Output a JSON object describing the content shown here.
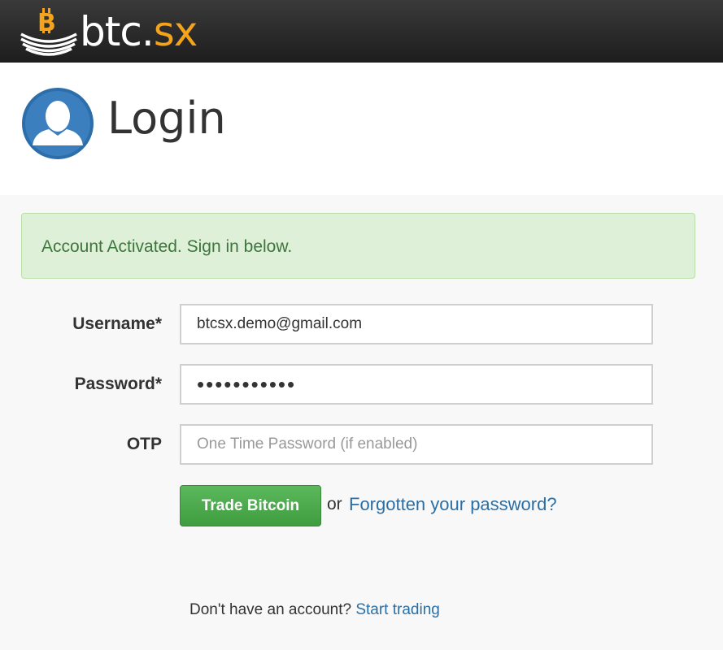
{
  "brand": {
    "name_main": "btc",
    "name_dot": ".",
    "name_sx": "sx",
    "accent_color": "#f4a31a",
    "icon": "bitcoin-coins-icon"
  },
  "header": {
    "title": "Login",
    "icon": "user-avatar-icon",
    "avatar_color": "#2c6eaa"
  },
  "alert": {
    "message": "Account Activated. Sign in below.",
    "background": "#dff0d8",
    "text_color": "#3c763d"
  },
  "form": {
    "username_label": "Username*",
    "username_value": "btcsx.demo@gmail.com",
    "password_label": "Password*",
    "password_value": "•••••••••••",
    "otp_label": "OTP",
    "otp_placeholder": "One Time Password (if enabled)",
    "submit_label": "Trade Bitcoin",
    "submit_color": "#4cae4c",
    "or_text": "or",
    "forgot_label": "Forgotten your password?"
  },
  "footer": {
    "prompt": "Don't have an account?",
    "signup_label": "Start trading",
    "link_color": "#2a6ea6"
  }
}
